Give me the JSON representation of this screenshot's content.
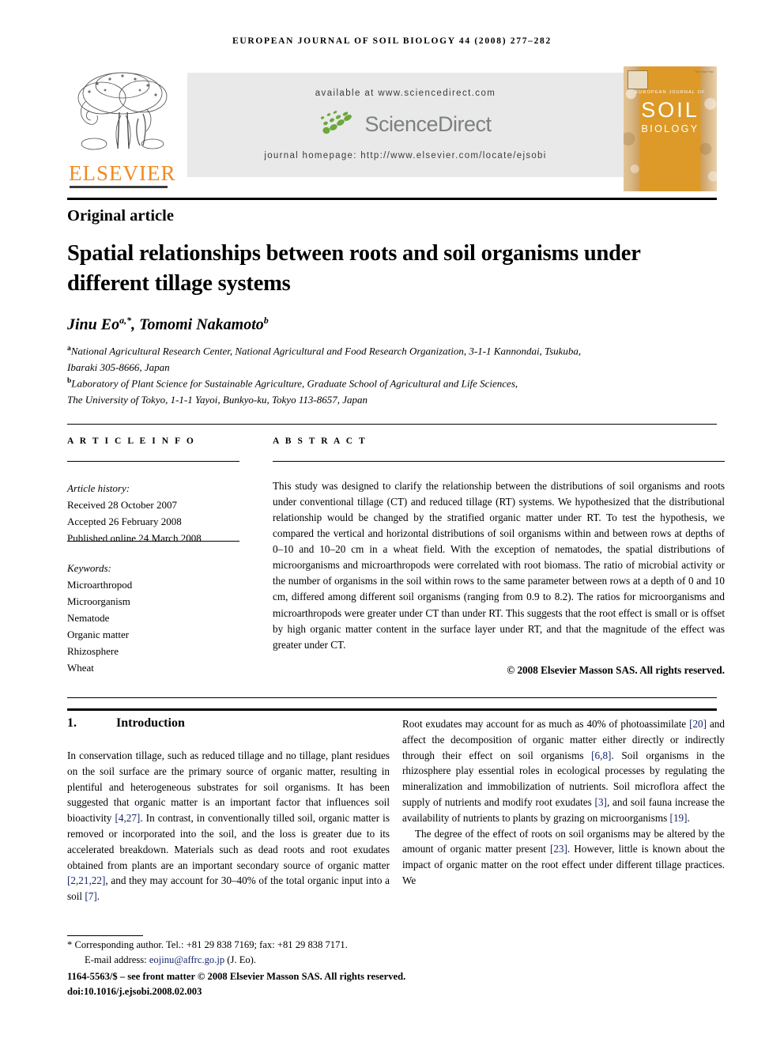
{
  "running_head": "EUROPEAN JOURNAL OF SOIL BIOLOGY 44 (2008) 277–282",
  "masthead": {
    "publisher_name": "ELSEVIER",
    "available_at": "available at www.sciencedirect.com",
    "sciencedirect_wordmark": "ScienceDirect",
    "journal_homepage": "journal homepage: http://www.elsevier.com/locate/ejsobi",
    "cover": {
      "line1": "EUROPEAN JOURNAL OF",
      "line2": "SOIL",
      "line3": "BIOLOGY",
      "corner_note": "The Year Past"
    }
  },
  "article": {
    "type": "Original article",
    "title": "Spatial relationships between roots and soil organisms under different tillage systems",
    "authors_html": "Jinu Eo<sup>a,*</sup>, Tomomi Nakamoto<sup>b</sup>",
    "affiliations_html": "<sup>a</sup>National Agricultural Research Center, National Agricultural and Food Research Organization, 3-1-1 Kannondai, Tsukuba,<br>Ibaraki 305-8666, Japan<br><sup>b</sup>Laboratory of Plant Science for Sustainable Agriculture, Graduate School of Agricultural and Life Sciences,<br>The University of Tokyo, 1-1-1 Yayoi, Bunkyo-ku, Tokyo 113-8657, Japan"
  },
  "article_info": {
    "heading": "A R T I C L E  I N F O",
    "history_label": "Article history:",
    "history": [
      "Received 28 October 2007",
      "Accepted 26 February 2008",
      "Published online 24 March 2008"
    ],
    "keywords_label": "Keywords:",
    "keywords": [
      "Microarthropod",
      "Microorganism",
      "Nematode",
      "Organic matter",
      "Rhizosphere",
      "Wheat"
    ]
  },
  "abstract": {
    "heading": "A B S T R A C T",
    "text": "This study was designed to clarify the relationship between the distributions of soil organisms and roots under conventional tillage (CT) and reduced tillage (RT) systems. We hypothesized that the distributional relationship would be changed by the stratified organic matter under RT. To test the hypothesis, we compared the vertical and horizontal distributions of soil organisms within and between rows at depths of 0–10 and 10–20 cm in a wheat field. With the exception of nematodes, the spatial distributions of microorganisms and microarthropods were correlated with root biomass. The ratio of microbial activity or the number of organisms in the soil within rows to the same parameter between rows at a depth of 0 and 10 cm, differed among different soil organisms (ranging from 0.9 to 8.2). The ratios for microorganisms and microarthropods were greater under CT than under RT. This suggests that the root effect is small or is offset by high organic matter content in the surface layer under RT, and that the magnitude of the effect was greater under CT.",
    "copyright": "© 2008 Elsevier Masson SAS. All rights reserved."
  },
  "body": {
    "section_number": "1.",
    "section_title": "Introduction",
    "left_column_html": "<p>In conservation tillage, such as reduced tillage and no tillage, plant residues on the soil surface are the primary source of organic matter, resulting in plentiful and heterogeneous substrates for soil organisms. It has been suggested that organic matter is an important factor that influences soil bioactivity <span class=\"ref\">[4,27]</span>. In contrast, in conventionally tilled soil, organic matter is removed or incorporated into the soil, and the loss is greater due to its accelerated breakdown. Materials such as dead roots and root exudates obtained from plants are an important secondary source of organic matter <span class=\"ref\">[2,21,22]</span>, and they may account for 30–40% of the total organic input into a soil <span class=\"ref\">[7]</span>.</p>",
    "right_column_html": "<p>Root exudates may account for as much as 40% of photoassimilate <span class=\"ref\">[20]</span> and affect the decomposition of organic matter either directly or indirectly through their effect on soil organisms <span class=\"ref\">[6,8]</span>. Soil organisms in the rhizosphere play essential roles in ecological processes by regulating the mineralization and immobilization of nutrients. Soil microflora affect the supply of nutrients and modify root exudates <span class=\"ref\">[3]</span>, and soil fauna increase the availability of nutrients to plants by grazing on microorganisms <span class=\"ref\">[19]</span>.</p><p>The degree of the effect of roots on soil organisms may be altered by the amount of organic matter present <span class=\"ref\">[23]</span>. However, little is known about the impact of organic matter on the root effect under different tillage practices. We</p>"
  },
  "footer": {
    "corresponding": "* Corresponding author. Tel.: +81 29 838 7169; fax: +81 29 838 7171.",
    "email_label": "E-mail address:",
    "email": "eojinu@affrc.go.jp",
    "email_suffix": "(J. Eo).",
    "issn_line": "1164-5563/$ – see front matter © 2008 Elsevier Masson SAS. All rights reserved.",
    "doi_line": "doi:10.1016/j.ejsobi.2008.02.003"
  },
  "colors": {
    "elsevier_orange": "#f08a24",
    "sciencedirect_green": "#6aa83a",
    "sciencedirect_gray": "#7d8083",
    "reference_blue": "#16256b",
    "cover_gold": "#dd9a28"
  }
}
